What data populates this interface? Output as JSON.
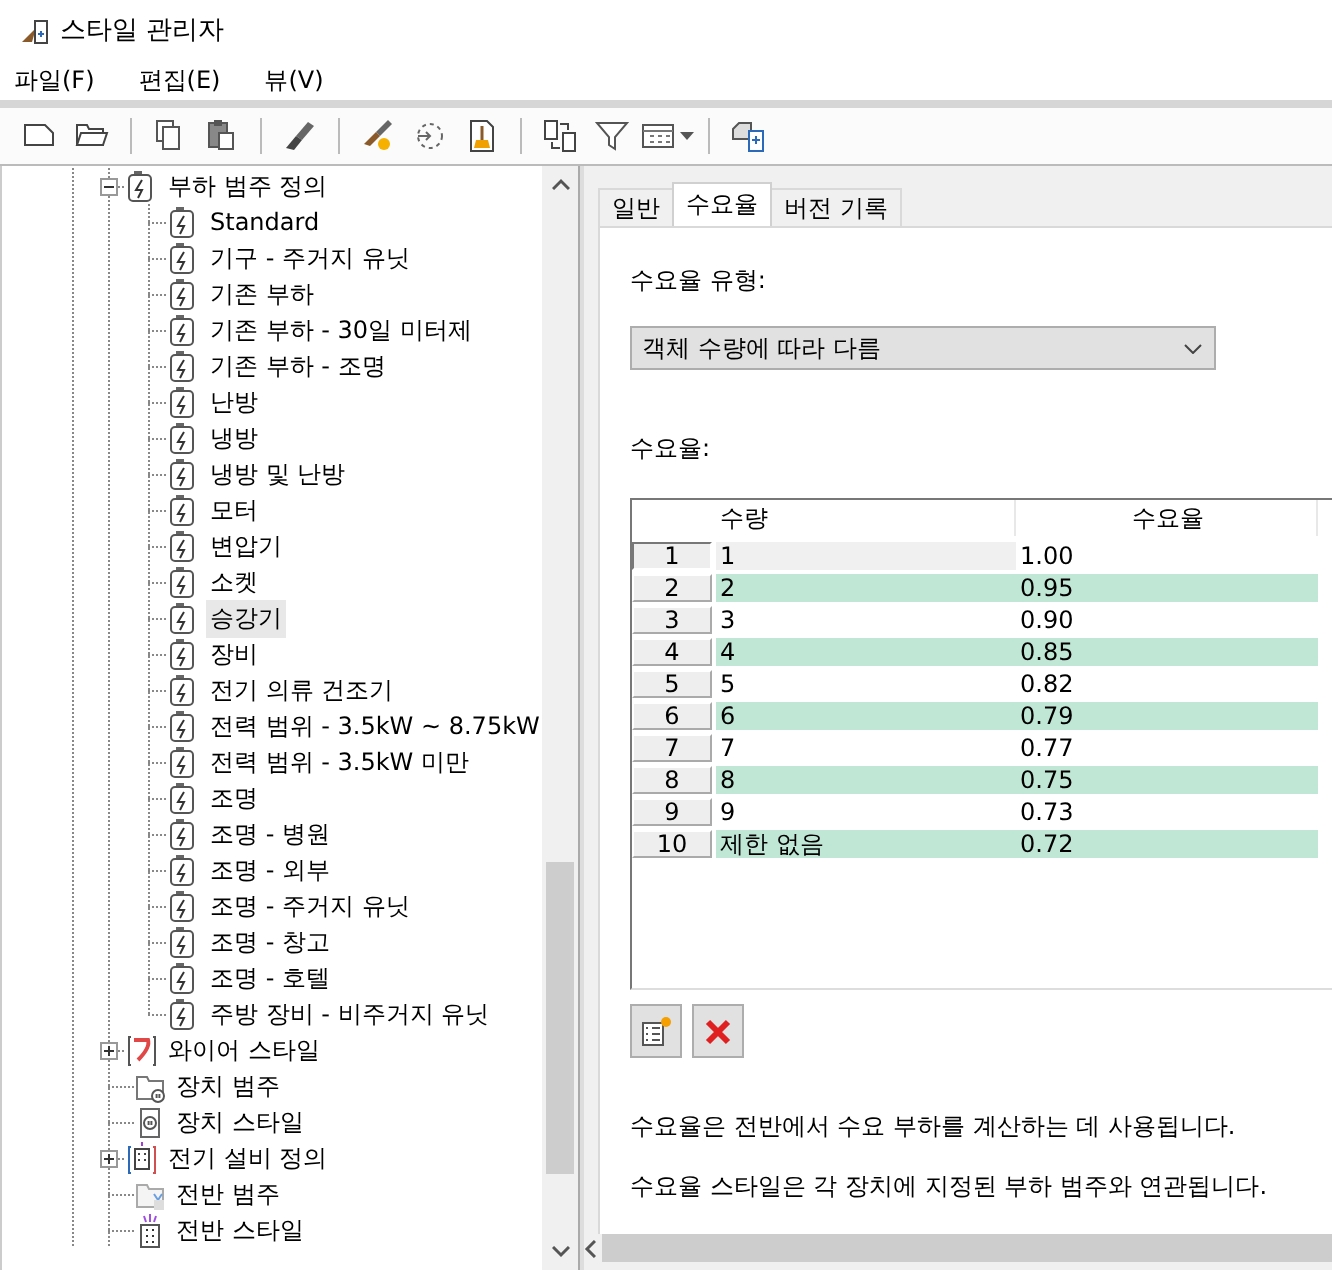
{
  "window": {
    "title": "스타일 관리자"
  },
  "menu": [
    {
      "label": "파일(F)"
    },
    {
      "label": "편집(E)"
    },
    {
      "label": "뷰(V)"
    }
  ],
  "tree": {
    "items": [
      {
        "label": "부하 범주 정의",
        "kind": "load",
        "expanded": true,
        "selected": false,
        "children": [
          {
            "label": "Standard",
            "kind": "load",
            "selected": false
          },
          {
            "label": "기구 - 주거지 유닛",
            "kind": "load",
            "selected": false
          },
          {
            "label": "기존 부하",
            "kind": "load",
            "selected": false
          },
          {
            "label": "기존 부하 - 30일 미터제",
            "kind": "load",
            "selected": false
          },
          {
            "label": "기존 부하 - 조명",
            "kind": "load",
            "selected": false
          },
          {
            "label": "난방",
            "kind": "load",
            "selected": false
          },
          {
            "label": "냉방",
            "kind": "load",
            "selected": false
          },
          {
            "label": "냉방 및 난방",
            "kind": "load",
            "selected": false
          },
          {
            "label": "모터",
            "kind": "load",
            "selected": false
          },
          {
            "label": "변압기",
            "kind": "load",
            "selected": false
          },
          {
            "label": "소켓",
            "kind": "load",
            "selected": false
          },
          {
            "label": "승강기",
            "kind": "load",
            "selected": true
          },
          {
            "label": "장비",
            "kind": "load",
            "selected": false
          },
          {
            "label": "전기 의류 건조기",
            "kind": "load",
            "selected": false
          },
          {
            "label": "전력 범위 - 3.5kW ~ 8.75kW",
            "kind": "load",
            "selected": false
          },
          {
            "label": "전력 범위 - 3.5kW 미만",
            "kind": "load",
            "selected": false
          },
          {
            "label": "조명",
            "kind": "load",
            "selected": false
          },
          {
            "label": "조명 - 병원",
            "kind": "load",
            "selected": false
          },
          {
            "label": "조명 - 외부",
            "kind": "load",
            "selected": false
          },
          {
            "label": "조명 - 주거지 유닛",
            "kind": "load",
            "selected": false
          },
          {
            "label": "조명 - 창고",
            "kind": "load",
            "selected": false
          },
          {
            "label": "조명 - 호텔",
            "kind": "load",
            "selected": false
          },
          {
            "label": "주방 장비 - 비주거지 유닛",
            "kind": "load",
            "selected": false
          }
        ]
      },
      {
        "label": "와이어 스타일",
        "kind": "wire",
        "expanded": false,
        "selected": false
      },
      {
        "label": "장치 범주",
        "kind": "device-category",
        "selected": false
      },
      {
        "label": "장치 스타일",
        "kind": "device-style",
        "selected": false
      },
      {
        "label": "전기 설비 정의",
        "kind": "equipment",
        "expanded": false,
        "selected": false
      },
      {
        "label": "전반 범주",
        "kind": "panel-category",
        "selected": false
      },
      {
        "label": "전반 스타일",
        "kind": "panel-style",
        "selected": false
      }
    ]
  },
  "tabs": [
    {
      "label": "일반",
      "selected": false
    },
    {
      "label": "수요율",
      "selected": true
    },
    {
      "label": "버전 기록",
      "selected": false
    }
  ],
  "demand_type": {
    "label": "수요율 유형:",
    "value": "객체 수량에 따라 다름"
  },
  "grid": {
    "label": "수요율:",
    "columns": [
      "수량",
      "수요율"
    ],
    "rows": [
      {
        "number": "1",
        "quantity": "1",
        "factor": "1.00",
        "selected": true
      },
      {
        "number": "2",
        "quantity": "2",
        "factor": "0.95",
        "selected": false
      },
      {
        "number": "3",
        "quantity": "3",
        "factor": "0.90",
        "selected": false
      },
      {
        "number": "4",
        "quantity": "4",
        "factor": "0.85",
        "selected": false
      },
      {
        "number": "5",
        "quantity": "5",
        "factor": "0.82",
        "selected": false
      },
      {
        "number": "6",
        "quantity": "6",
        "factor": "0.79",
        "selected": false
      },
      {
        "number": "7",
        "quantity": "7",
        "factor": "0.77",
        "selected": false
      },
      {
        "number": "8",
        "quantity": "8",
        "factor": "0.75",
        "selected": false
      },
      {
        "number": "9",
        "quantity": "9",
        "factor": "0.73",
        "selected": false
      },
      {
        "number": "10",
        "quantity": "제한 없음",
        "factor": "0.72",
        "selected": false
      }
    ]
  },
  "notes": [
    "수요율은 전반에서 수요 부하를 계산하는 데 사용됩니다.",
    "수요율 스타일은 각 장치에 지정된 부하 범주와 연관됩니다."
  ]
}
